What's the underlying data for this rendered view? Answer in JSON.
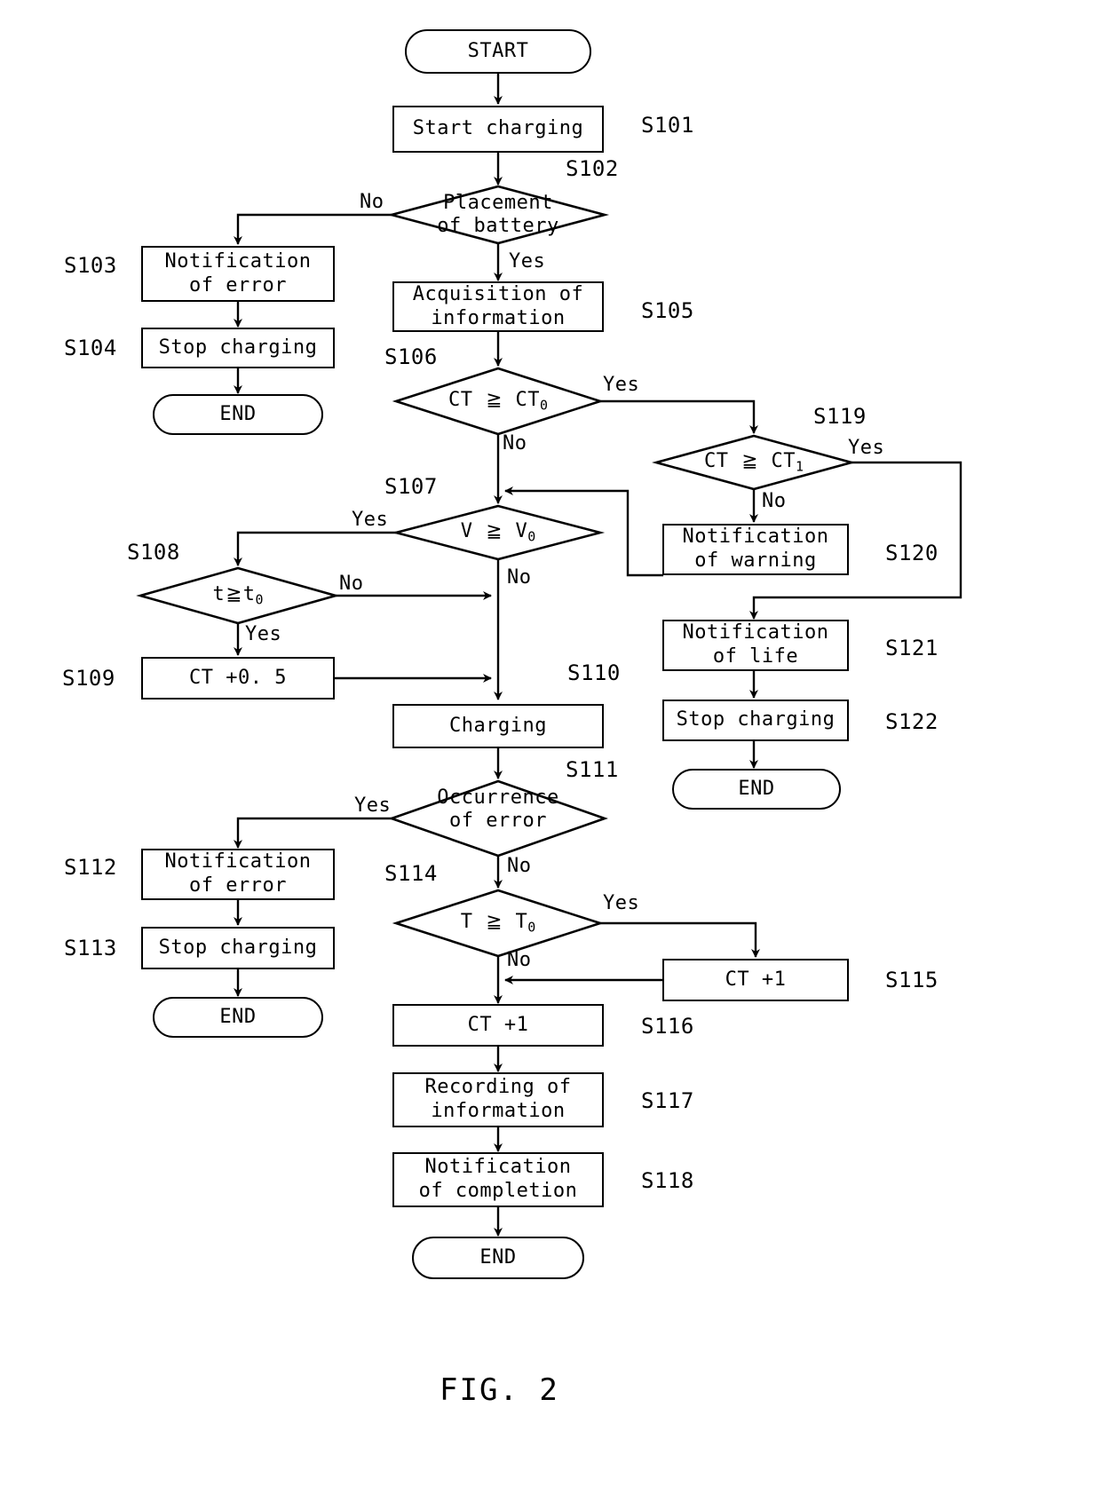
{
  "figure": {
    "caption": "FIG. 2"
  },
  "nodes": {
    "start": {
      "label": "START",
      "ref": ""
    },
    "s101": {
      "label": "Start charging",
      "ref": "S101"
    },
    "s102": {
      "label": "Placement\nof battery",
      "ref": "S102"
    },
    "s103": {
      "label": "Notification\nof error",
      "ref": "S103"
    },
    "s104": {
      "label": "Stop charging",
      "ref": "S104"
    },
    "end_left": {
      "label": "END",
      "ref": ""
    },
    "s105": {
      "label": "Acquisition of\ninformation",
      "ref": "S105"
    },
    "s106": {
      "label": "CT ≧ CT0",
      "ref": "S106"
    },
    "s107": {
      "label": "V ≧ V0",
      "ref": "S107"
    },
    "s108": {
      "label": "t≧t0",
      "ref": "S108"
    },
    "s109": {
      "label": "CT +0. 5",
      "ref": "S109"
    },
    "s110": {
      "label": "Charging",
      "ref": "S110"
    },
    "s111": {
      "label": "Occurrence\nof error",
      "ref": "S111"
    },
    "s112": {
      "label": "Notification\nof error",
      "ref": "S112"
    },
    "s113": {
      "label": "Stop charging",
      "ref": "S113"
    },
    "end_mid_left": {
      "label": "END",
      "ref": ""
    },
    "s114": {
      "label": "T ≧ T0",
      "ref": "S114"
    },
    "s115": {
      "label": "CT +1",
      "ref": "S115"
    },
    "s116": {
      "label": "CT +1",
      "ref": "S116"
    },
    "s117": {
      "label": "Recording of\ninformation",
      "ref": "S117"
    },
    "s118": {
      "label": "Notification\nof completion",
      "ref": "S118"
    },
    "end_bottom": {
      "label": "END",
      "ref": ""
    },
    "s119": {
      "label": "CT ≧ CT1",
      "ref": "S119"
    },
    "s120": {
      "label": "Notification\nof warning",
      "ref": "S120"
    },
    "s121": {
      "label": "Notification\nof life",
      "ref": "S121"
    },
    "s122": {
      "label": "Stop charging",
      "ref": "S122"
    },
    "end_right": {
      "label": "END",
      "ref": ""
    }
  },
  "edge_labels": {
    "s102_no": "No",
    "s102_yes": "Yes",
    "s106_yes": "Yes",
    "s106_no": "No",
    "s107_yes": "Yes",
    "s107_no": "No",
    "s108_no": "No",
    "s108_yes": "Yes",
    "s111_yes": "Yes",
    "s111_no": "No",
    "s114_yes": "Yes",
    "s114_no": "No",
    "s119_yes": "Yes",
    "s119_no": "No"
  },
  "colors": {
    "stroke": "#000000",
    "background": "#ffffff"
  }
}
